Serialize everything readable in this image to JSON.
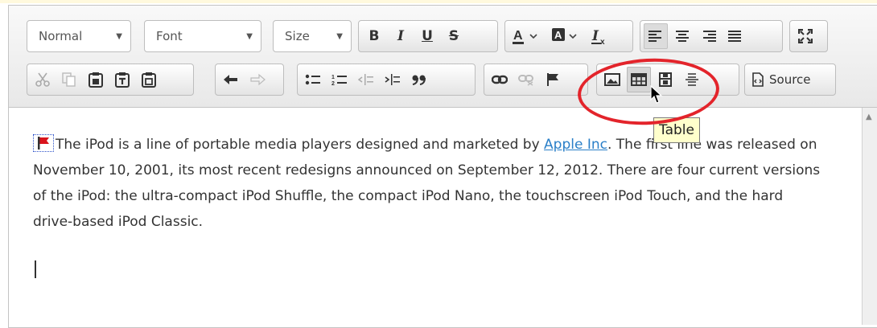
{
  "toolbar": {
    "format_combo": {
      "value": "Normal"
    },
    "font_combo": {
      "value": "Font"
    },
    "size_combo": {
      "value": "Size"
    },
    "bold_label": "B",
    "italic_label": "I",
    "underline_label": "U",
    "strike_label": "S",
    "source_label": "Source"
  },
  "tooltip": {
    "text": "Table"
  },
  "content": {
    "para_before_link": "The iPod is a line of portable media players designed and marketed by ",
    "link_text": "Apple Inc",
    "para_after_link": ". The first line was released on November 10, 2001, its most recent redesigns announced on September 12, 2012. There are four current versions of the iPod: the ultra-compact iPod Shuffle, the compact iPod Nano, the touchscreen iPod Touch, and the hard drive-based iPod Classic."
  },
  "colors": {
    "highlight_ring": "#e3242b",
    "link": "#2a7fc8",
    "tooltip_bg": "#ffffcc"
  }
}
